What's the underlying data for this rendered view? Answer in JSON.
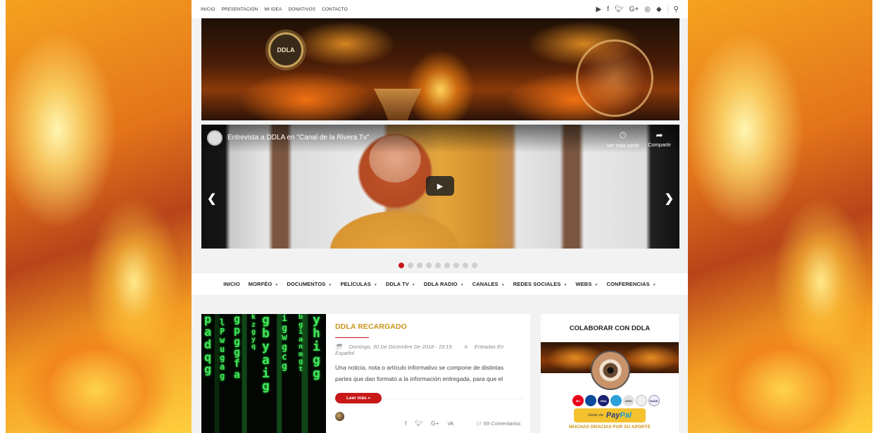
{
  "topbar": {
    "nav": [
      "INICIO",
      "PRESENTACIÓN",
      "MI IDEA",
      "DONATIVOS",
      "CONTACTO"
    ],
    "icons": [
      "youtube-icon",
      "facebook-icon",
      "twitter-icon",
      "google-plus-icon",
      "instagram-icon",
      "android-icon",
      "search-icon"
    ]
  },
  "banner": {
    "logo_text": "DDLA"
  },
  "video": {
    "title": "Entrevista a DDLA en \"Canal de la Rivera Tv\"",
    "watch_later": "Ver más tarde",
    "share": "Compartir"
  },
  "slider": {
    "dot_count": 9,
    "active_index": 0
  },
  "mainnav": {
    "items": [
      {
        "label": "INICIO",
        "has_menu": false
      },
      {
        "label": "MORFÉO",
        "has_menu": true
      },
      {
        "label": "DOCUMENTOS",
        "has_menu": true
      },
      {
        "label": "PELÍCULAS",
        "has_menu": true
      },
      {
        "label": "DDLA TV",
        "has_menu": true
      },
      {
        "label": "DDLA RADIO",
        "has_menu": true
      },
      {
        "label": "CANALES",
        "has_menu": true
      },
      {
        "label": "REDES SOCIALES",
        "has_menu": true
      },
      {
        "label": "WEBS",
        "has_menu": true
      },
      {
        "label": "CONFERENCIAS",
        "has_menu": true
      }
    ]
  },
  "post": {
    "title": "DDLA RECARGADO",
    "date": "Domingo, 30 De Diciembre De 2018 - 19:19",
    "category": "Entradas En Español",
    "excerpt": "Una noticia, nota o artículo informativo se compone de distintas partes que dan formato a la información entregada, para que el",
    "read_more": "Leer más »",
    "comments": "69 Comentarios"
  },
  "sidebar": {
    "title": "COLABORAR CON DDLA",
    "paypal_prefix": "Donar vía",
    "paypal_brand_a": "Pay",
    "paypal_brand_b": "Pal",
    "thanks": "MUCHAS GRACIAS POR SU APORTE",
    "card_labels": [
      "MC",
      "",
      "VISA",
      "",
      "DISC",
      "",
      "BANK"
    ]
  },
  "colors": {
    "accent_red": "#c81818",
    "post_title_gold": "#c9931a"
  }
}
